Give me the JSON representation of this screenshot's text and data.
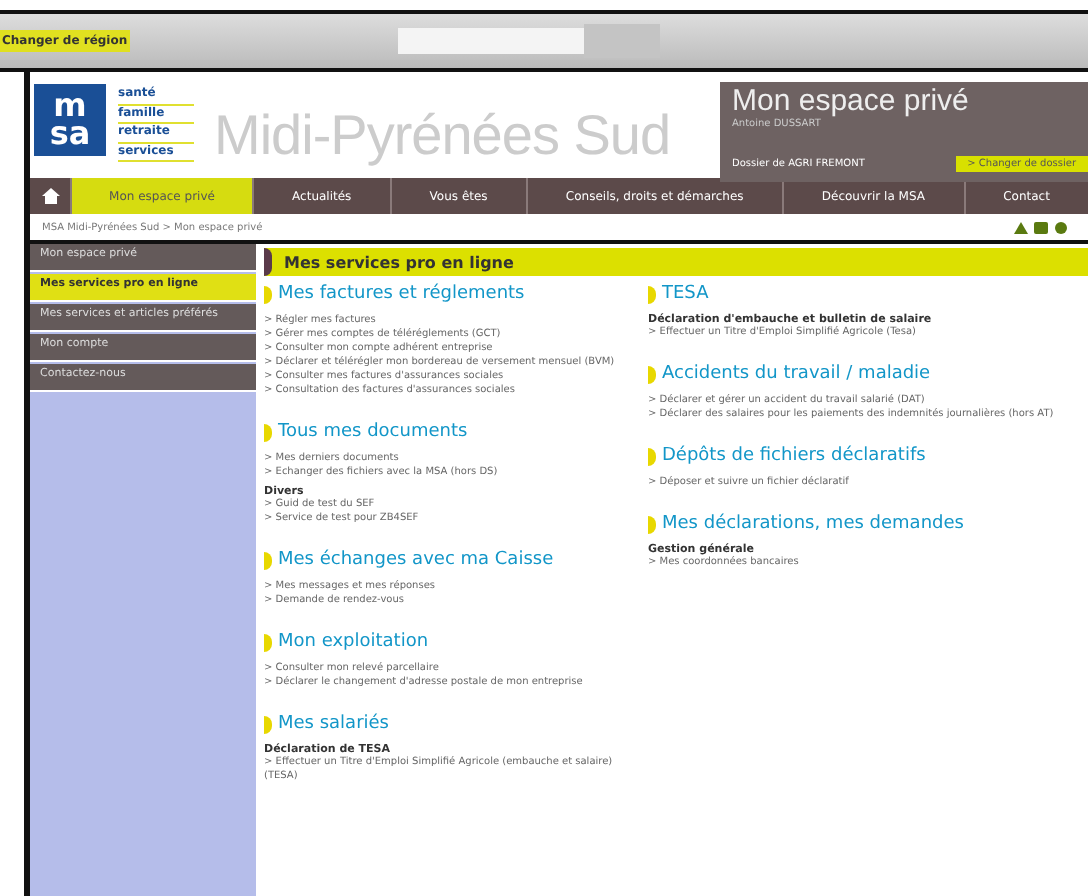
{
  "top_bar": {
    "region_link": "Changer de région"
  },
  "header": {
    "logo_tagline": [
      "santé",
      "famille",
      "retraite",
      "services"
    ],
    "logo_letters": [
      "m",
      "sa"
    ],
    "region": "Midi-Pyrénées Sud",
    "private_space": {
      "title": "Mon espace privé",
      "user": "Antoine DUSSART",
      "dossier": "Dossier de AGRI FREMONT",
      "change_link": "> Changer de dossier"
    }
  },
  "nav": [
    {
      "label": "Mon espace privé",
      "selected": true
    },
    {
      "label": "Actualités",
      "selected": false
    },
    {
      "label": "Vous êtes",
      "selected": false
    },
    {
      "label": "Conseils, droits et démarches",
      "selected": false
    },
    {
      "label": "Découvrir la MSA",
      "selected": false
    },
    {
      "label": "Contact",
      "selected": false
    }
  ],
  "breadcrumb": "MSA Midi-Pyrénées Sud > Mon espace privé",
  "sidebar": [
    {
      "label": "Mon espace privé",
      "selected": false
    },
    {
      "label": "Mes services pro en ligne",
      "selected": true
    },
    {
      "label": "Mes services et articles préférés",
      "selected": false
    },
    {
      "label": "Mon compte",
      "selected": false
    },
    {
      "label": "Contactez-nous",
      "selected": false
    }
  ],
  "page_title": "Mes services pro en ligne",
  "columns": [
    [
      {
        "title": "Mes factures et réglements",
        "blocks": [
          {
            "links": [
              "> Régler mes factures",
              "> Gérer mes comptes de téléréglements (GCT)",
              "> Consulter mon compte adhérent entreprise",
              "> Déclarer et télérégler mon bordereau de versement mensuel (BVM)",
              "> Consulter mes factures d'assurances sociales",
              "> Consultation des factures d'assurances sociales"
            ]
          }
        ]
      },
      {
        "title": "Tous mes documents",
        "blocks": [
          {
            "links": [
              "> Mes derniers documents",
              "> Echanger des fichiers avec la MSA (hors DS)"
            ]
          },
          {
            "heading": "Divers",
            "links": [
              "> Guid de test du SEF",
              "> Service de test pour ZB4SEF"
            ]
          }
        ]
      },
      {
        "title": "Mes échanges avec ma Caisse",
        "blocks": [
          {
            "links": [
              "> Mes messages et mes réponses",
              "> Demande de rendez-vous"
            ]
          }
        ]
      },
      {
        "title": "Mon exploitation",
        "blocks": [
          {
            "links": [
              "> Consulter mon relevé parcellaire",
              "> Déclarer le changement d'adresse postale de mon entreprise"
            ]
          }
        ]
      },
      {
        "title": "Mes salariés",
        "blocks": [
          {
            "heading": "Déclaration de TESA",
            "links": [
              "> Effectuer un Titre d'Emploi Simplifié Agricole (embauche et salaire) (TESA)"
            ]
          }
        ]
      }
    ],
    [
      {
        "title": "TESA",
        "blocks": [
          {
            "heading": "Déclaration d'embauche et bulletin de salaire",
            "links": [
              "> Effectuer un Titre d'Emploi Simplifié Agricole (Tesa)"
            ]
          }
        ]
      },
      {
        "title": "Accidents du travail / maladie",
        "blocks": [
          {
            "links": [
              "> Déclarer et gérer un accident du travail salarié (DAT)",
              "> Déclarer des salaires pour les paiements des indemnités journalières (hors AT)"
            ]
          }
        ]
      },
      {
        "title": "Dépôts de fichiers déclaratifs",
        "blocks": [
          {
            "links": [
              "> Déposer et suivre un fichier déclaratif"
            ]
          }
        ]
      },
      {
        "title": "Mes déclarations, mes demandes",
        "blocks": [
          {
            "heading": "Gestion générale",
            "links": [
              "> Mes coordonnées bancaires"
            ]
          }
        ]
      }
    ]
  ]
}
